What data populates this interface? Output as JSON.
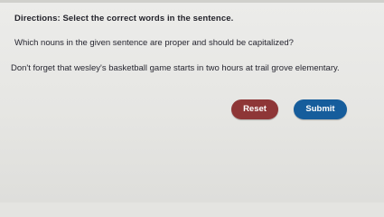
{
  "directions": "Directions: Select the correct words in the sentence.",
  "question": "Which nouns in the given sentence are proper and should be capitalized?",
  "sentence_words": [
    "Don't",
    "forget",
    "that",
    "wesley's",
    "basketball",
    "game",
    "starts",
    "in",
    "two",
    "hours",
    "at",
    "trail",
    "grove",
    "elementary."
  ],
  "buttons": {
    "reset_label": "Reset",
    "submit_label": "Submit"
  },
  "colors": {
    "reset": "#8e3637",
    "submit": "#165d9c",
    "background": "#e6e6e3"
  }
}
